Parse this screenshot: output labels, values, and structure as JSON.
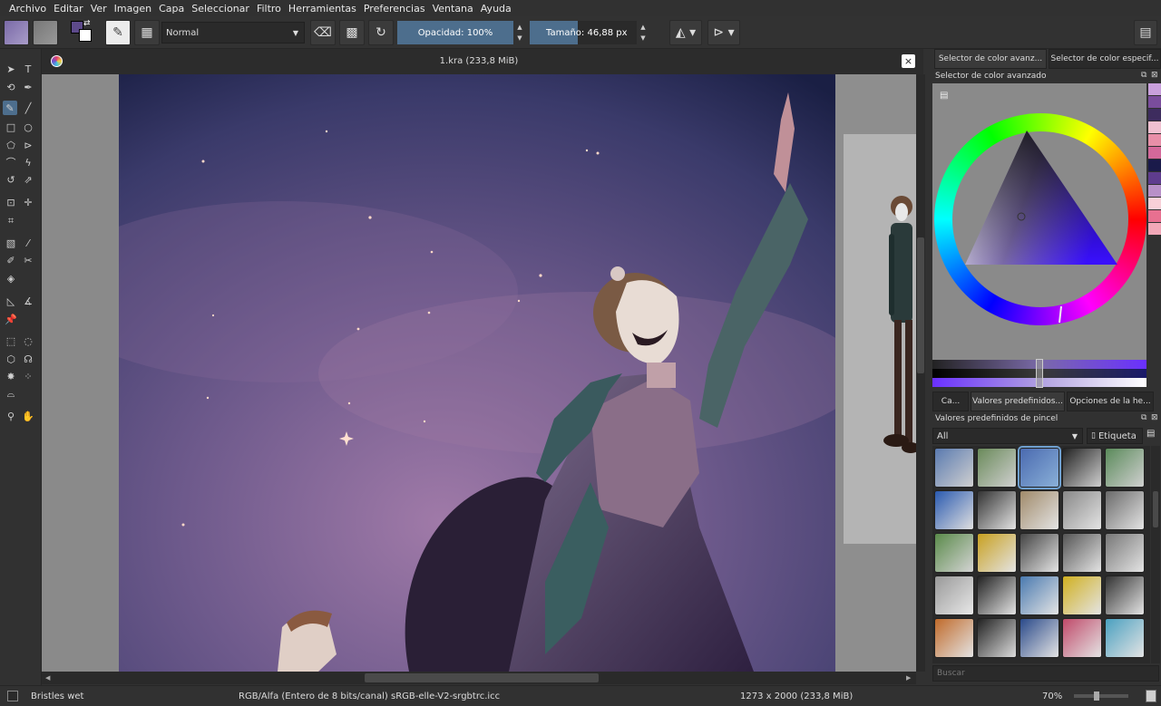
{
  "menu": [
    "Archivo",
    "Editar",
    "Ver",
    "Imagen",
    "Capa",
    "Seleccionar",
    "Filtro",
    "Herramientas",
    "Preferencias",
    "Ventana",
    "Ayuda"
  ],
  "toolbar": {
    "blend_mode": "Normal",
    "opacity_label": "Opacidad:",
    "opacity_value": "100%",
    "size_label": "Tamaño:",
    "size_value": "46,88 px"
  },
  "document": {
    "tab_title": "1.kra (233,8 MiB)"
  },
  "dock": {
    "color_tabs": [
      "Selector de color avanz...",
      "Selector de color especif..."
    ],
    "color_panel_title": "Selector de color avanzado",
    "preset_tabs": [
      "Ca...",
      "Valores predefinidos...",
      "Opciones de la he..."
    ],
    "preset_panel_title": "Valores predefinidos de pincel",
    "filter_value": "All",
    "tag_label": "Etiqueta",
    "search_placeholder": "Buscar",
    "swatches": [
      "#c9a0dc",
      "#7a4d9c",
      "#3d2c5e",
      "#f0c0d0",
      "#e88fa8",
      "#d4689a",
      "#1a1a4a",
      "#5e3c8e",
      "#b890c8",
      "#f8d0d8",
      "#e87090",
      "#f2a8b8"
    ]
  },
  "status": {
    "brush_name": "Bristles wet",
    "color_info": "RGB/Alfa (Entero de 8 bits/canal)  sRGB-elle-V2-srgbtrc.icc",
    "image_size": "1273 x 2000 (233,8 MiB)",
    "zoom": "70%"
  },
  "colors": {
    "accent": "#4d6e8d",
    "fg_color": "#5d4a8a",
    "bg_color": "#ffffff"
  }
}
